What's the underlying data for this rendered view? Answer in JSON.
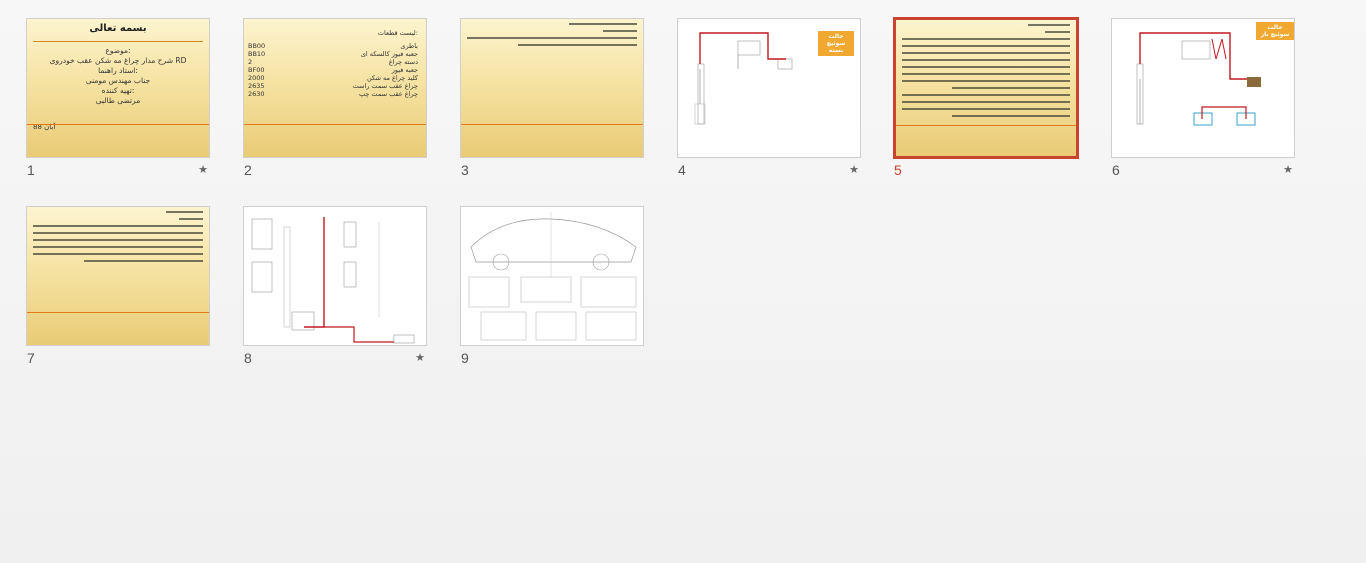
{
  "slides": [
    {
      "number": "1",
      "starred": true,
      "title": "بسمه تعالی",
      "lines": [
        "موضوع:",
        "شرح مدار چراغ مه شکن عقب خودروی RD",
        "استاد راهنما:",
        "جناب مهندس مومنی",
        "تهیه کننده:",
        "مرتضی طالبی"
      ],
      "footer": "آبان 88"
    },
    {
      "number": "2",
      "starred": false,
      "heading": "لیست قطعات:",
      "rows": [
        [
          "BB00",
          "باطری"
        ],
        [
          "BB10",
          "جعبه فیوز کالسکه ای"
        ],
        [
          "2",
          "دسته چراغ"
        ],
        [
          "BF00",
          "جعبه فیوز"
        ],
        [
          "2000",
          "کلید چراغ مه شکن"
        ],
        [
          "2635",
          "چراغ عقب سمت راست"
        ],
        [
          "2630",
          "چراغ عقب سمت چپ"
        ]
      ]
    },
    {
      "number": "3",
      "starred": false
    },
    {
      "number": "4",
      "starred": true,
      "tag": "حالت سوئیچ بسته"
    },
    {
      "number": "5",
      "starred": false,
      "selected": true
    },
    {
      "number": "6",
      "starred": true,
      "tag": "حالت سوئیچ باز"
    },
    {
      "number": "7",
      "starred": false
    },
    {
      "number": "8",
      "starred": true
    },
    {
      "number": "9",
      "starred": false
    }
  ],
  "star_glyph": "★",
  "colors": {
    "selection": "#c9432f",
    "wire": "#c0181e"
  }
}
